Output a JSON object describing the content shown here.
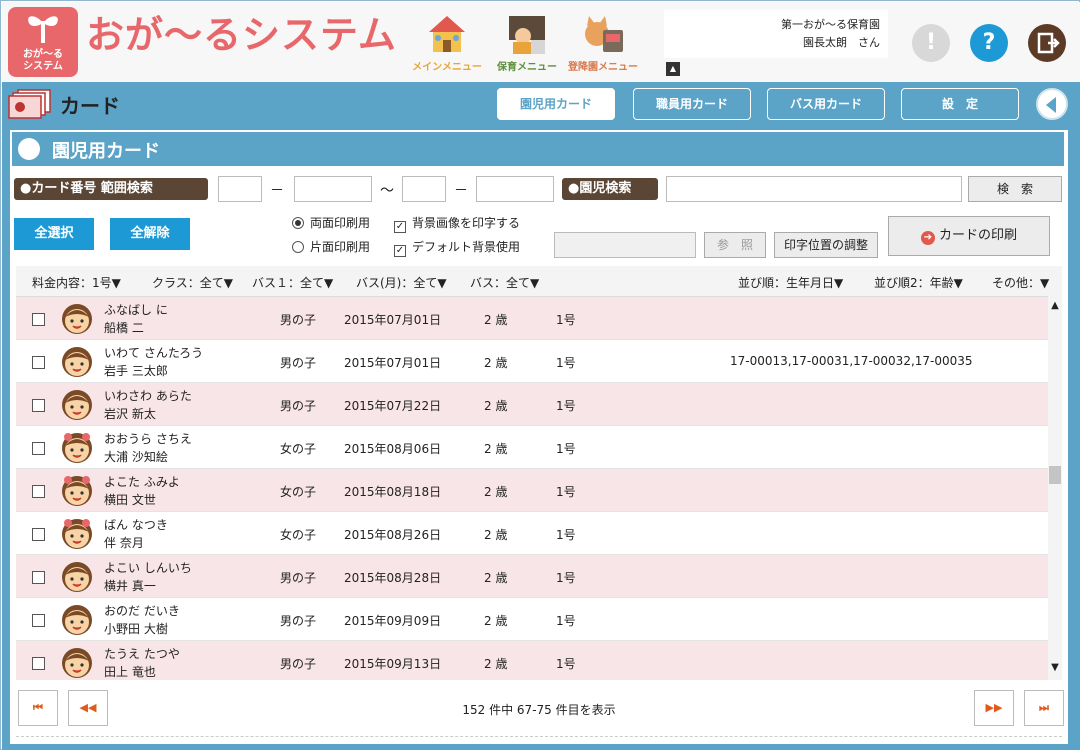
{
  "header": {
    "logo_line1": "おが～る",
    "logo_line2": "システム",
    "app_title": "おが～るシステム",
    "menus": [
      {
        "label": "メインメニュー",
        "color": "#e8a43a"
      },
      {
        "label": "保育メニュー",
        "color": "#5e8f3b"
      },
      {
        "label": "登降園メニュー",
        "color": "#d77a50"
      }
    ],
    "facility": "第一おが～る保育園",
    "user": "園長太朗　さん",
    "notice_icon": "!",
    "help_icon": "?"
  },
  "toolbar": {
    "title": "カード",
    "tabs": [
      {
        "label": "園児用カード",
        "active": true
      },
      {
        "label": "職員用カード",
        "active": false
      },
      {
        "label": "バス用カード",
        "active": false
      },
      {
        "label": "設　定",
        "active": false
      }
    ]
  },
  "section": {
    "title": "園児用カード"
  },
  "search": {
    "range_label": "●カード番号 範囲検索",
    "dash": "－",
    "tilde": "～",
    "child_label": "●園児検索",
    "search_button": "検　索"
  },
  "actions": {
    "select_all": "全選択",
    "deselect_all": "全解除",
    "duplex": "両面印刷用",
    "simplex": "片面印刷用",
    "print_bg": "背景画像を印字する",
    "default_bg": "デフォルト背景使用",
    "browse": "参　照",
    "adjust": "印字位置の調整",
    "print": "カードの印刷"
  },
  "filters": {
    "fee": "料金内容：1号▼",
    "class": "クラス：全て▼",
    "bus1": "バス１：全て▼",
    "bus_month": "バス(月)：全て▼",
    "bus": "バス：全て▼",
    "sort1": "並び順：生年月日▼",
    "sort2": "並び順2：年齢▼",
    "other": "その他：▼"
  },
  "rows": [
    {
      "kana": "ふなばし に",
      "kanji": "船橋 二",
      "gender": "男の子",
      "dob": "2015年07月01日",
      "age": "2 歳",
      "fee": "1号",
      "other": "",
      "girl": false
    },
    {
      "kana": "いわて さんたろう",
      "kanji": "岩手 三太郎",
      "gender": "男の子",
      "dob": "2015年07月01日",
      "age": "2 歳",
      "fee": "1号",
      "other": "17-00013,17-00031,17-00032,17-00035",
      "girl": false
    },
    {
      "kana": "いわさわ あらた",
      "kanji": "岩沢 新太",
      "gender": "男の子",
      "dob": "2015年07月22日",
      "age": "2 歳",
      "fee": "1号",
      "other": "",
      "girl": false
    },
    {
      "kana": "おおうら さちえ",
      "kanji": "大浦 沙知絵",
      "gender": "女の子",
      "dob": "2015年08月06日",
      "age": "2 歳",
      "fee": "1号",
      "other": "",
      "girl": true
    },
    {
      "kana": "よこた ふみよ",
      "kanji": "横田 文世",
      "gender": "女の子",
      "dob": "2015年08月18日",
      "age": "2 歳",
      "fee": "1号",
      "other": "",
      "girl": true
    },
    {
      "kana": "ばん なつき",
      "kanji": "伴 奈月",
      "gender": "女の子",
      "dob": "2015年08月26日",
      "age": "2 歳",
      "fee": "1号",
      "other": "",
      "girl": true
    },
    {
      "kana": "よこい しんいち",
      "kanji": "横井 真一",
      "gender": "男の子",
      "dob": "2015年08月28日",
      "age": "2 歳",
      "fee": "1号",
      "other": "",
      "girl": false
    },
    {
      "kana": "おのだ だいき",
      "kanji": "小野田 大樹",
      "gender": "男の子",
      "dob": "2015年09月09日",
      "age": "2 歳",
      "fee": "1号",
      "other": "",
      "girl": false
    },
    {
      "kana": "たうえ たつや",
      "kanji": "田上 竜也",
      "gender": "男の子",
      "dob": "2015年09月13日",
      "age": "2 歳",
      "fee": "1号",
      "other": "",
      "girl": false
    }
  ],
  "pager": {
    "info": "152 件中 67-75 件目を表示",
    "first": "⏮",
    "prev": "◀◀",
    "next": "▶▶",
    "last": "⏭"
  }
}
